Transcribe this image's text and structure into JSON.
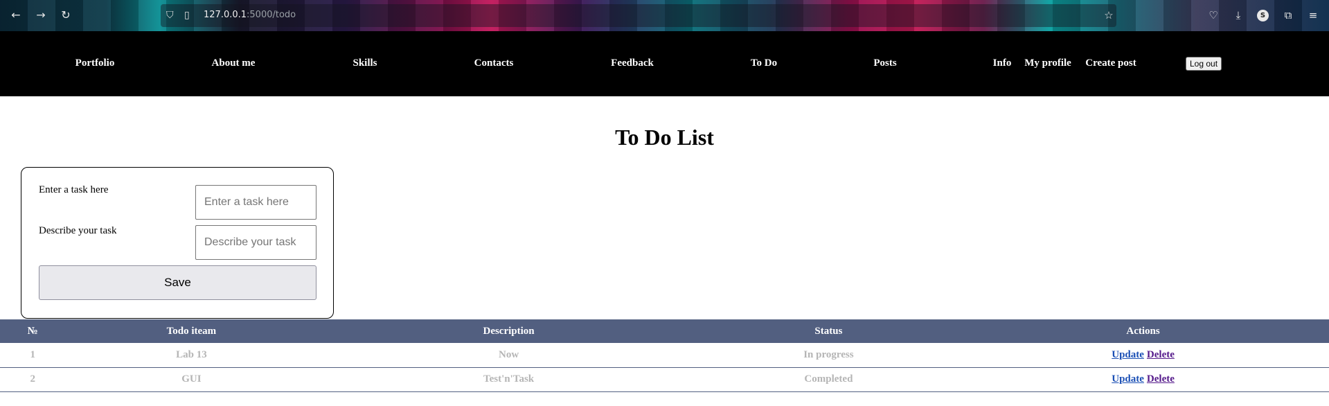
{
  "browser": {
    "url_host": "127.0.0.1",
    "url_path": ":5000/todo",
    "profile_initial": "S",
    "icons": [
      "back-arrow-icon",
      "forward-arrow-icon",
      "reload-icon",
      "shield-icon",
      "page-icon",
      "star-icon",
      "pocket-icon",
      "download-icon",
      "profile-icon",
      "extensions-icon",
      "menu-icon"
    ]
  },
  "nav": {
    "items": [
      {
        "label": "Portfolio"
      },
      {
        "label": "About me"
      },
      {
        "label": "Skills"
      },
      {
        "label": "Contacts"
      },
      {
        "label": "Feedback"
      },
      {
        "label": "To Do"
      },
      {
        "label": "Posts"
      },
      {
        "label": "Info"
      },
      {
        "label": "My profile"
      },
      {
        "label": "Create post"
      }
    ],
    "logout_label": "Log out"
  },
  "page": {
    "title": "To Do List"
  },
  "form": {
    "task_label": "Enter a task here",
    "task_placeholder": "Enter a task here",
    "desc_label": "Describe your task",
    "desc_placeholder": "Describe your task",
    "save_label": "Save"
  },
  "table": {
    "headers": [
      "№",
      "Todo iteam",
      "Description",
      "Status",
      "Actions"
    ],
    "rows": [
      {
        "num": "1",
        "item": "Lab 13",
        "description": "Now",
        "status": "In progress",
        "update": "Update",
        "delete": "Delete"
      },
      {
        "num": "2",
        "item": "GUI",
        "description": "Test'n'Task",
        "status": "Completed",
        "update": "Update",
        "delete": "Delete"
      }
    ],
    "header_color": "#525f80"
  }
}
